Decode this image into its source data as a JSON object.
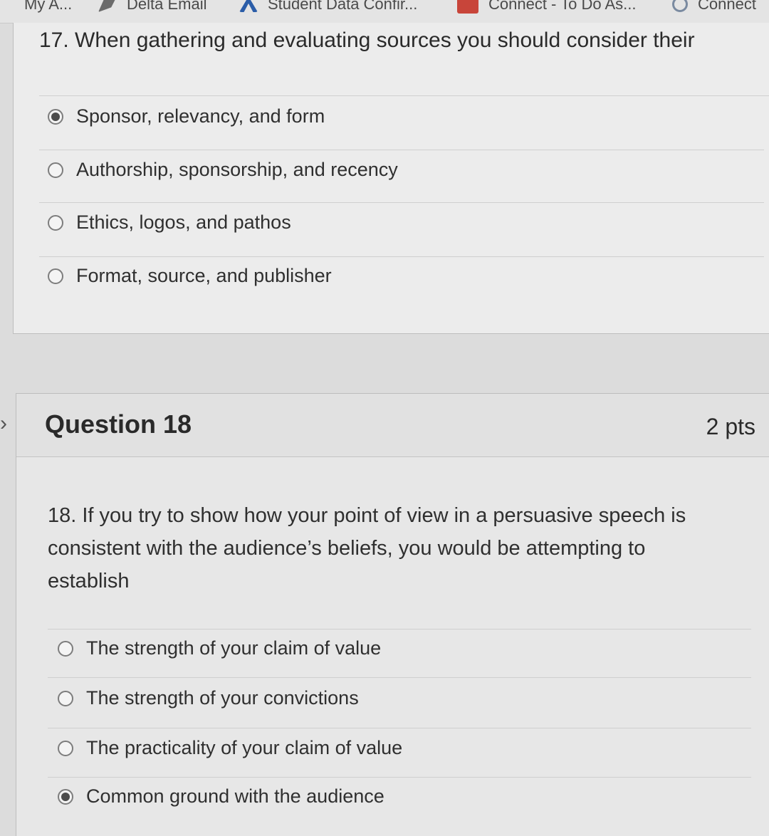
{
  "bookmarks": [
    {
      "label": "My A...",
      "icon": "none"
    },
    {
      "label": "Delta Email",
      "icon": "bird-icon"
    },
    {
      "label": "Student Data Confir...",
      "icon": "a-logo-icon"
    },
    {
      "label": "Connect - To Do As...",
      "icon": "mcgraw-hill-icon"
    },
    {
      "label": "Connect",
      "icon": "q-logo-icon"
    }
  ],
  "question17": {
    "text": "17. When gathering and evaluating sources you should consider their",
    "options": [
      {
        "label": "Sponsor, relevancy, and form",
        "selected": true
      },
      {
        "label": "Authorship, sponsorship, and recency",
        "selected": false
      },
      {
        "label": "Ethics, logos, and pathos",
        "selected": false
      },
      {
        "label": "Format, source, and publisher",
        "selected": false
      }
    ]
  },
  "question18": {
    "title": "Question 18",
    "points": "2 pts",
    "text": "18. If you try to show how your point of view in a persuasive speech is consistent with the audience’s beliefs, you would be attempting to establish",
    "options": [
      {
        "label": "The strength of your claim of value",
        "selected": false
      },
      {
        "label": "The strength of your convictions",
        "selected": false
      },
      {
        "label": "The practicality of your claim of value",
        "selected": false
      },
      {
        "label": "Common ground with the audience",
        "selected": true
      }
    ]
  },
  "colors": {
    "background": "#dcdcdc",
    "card": "#ececec",
    "text": "#2a2a2a",
    "radio_fill": "#4c4c4c"
  }
}
